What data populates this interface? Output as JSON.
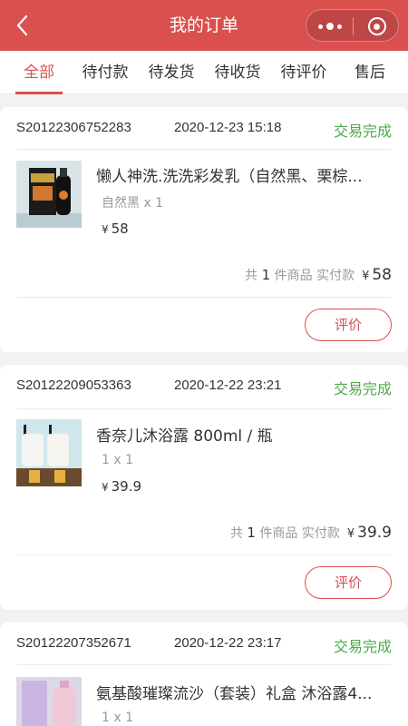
{
  "header": {
    "back_icon": "chevron-left-icon",
    "title": "我的订单",
    "more_icon": "more-dots-icon",
    "close_icon": "target-close-icon",
    "color": "#d9504f"
  },
  "tabs": [
    {
      "label": "全部",
      "active": true
    },
    {
      "label": "待付款"
    },
    {
      "label": "待发货"
    },
    {
      "label": "待收货"
    },
    {
      "label": "待评价"
    },
    {
      "label": "售后"
    }
  ],
  "summary_labels": {
    "prefix": "共",
    "unit": "件商品",
    "paid": "实付款",
    "currency": "¥"
  },
  "orders": [
    {
      "order_no": "S20122306752283",
      "time": "2020-12-23 15:18",
      "status": "交易完成",
      "product": {
        "name": "懒人神洗.洗洗彩发乳（自然黑、栗棕...",
        "spec": "自然黑 x 1",
        "price_symbol": "¥",
        "price": "58",
        "image": "hair-dye-bottle-image"
      },
      "count": "1",
      "total": "58",
      "action": "评价"
    },
    {
      "order_no": "S20122209053363",
      "time": "2020-12-22 23:21",
      "status": "交易完成",
      "product": {
        "name": "香奈儿沐浴露 800ml / 瓶",
        "spec": "1 x 1",
        "price_symbol": "¥",
        "price": "39.9",
        "image": "body-wash-bottles-image"
      },
      "count": "1",
      "total": "39.9",
      "action": "评价"
    },
    {
      "order_no": "S20122207352671",
      "time": "2020-12-22 23:17",
      "status": "交易完成",
      "product": {
        "name": "氨基酸璀璨流沙（套装）礼盒 沐浴露4...",
        "spec": "1 x 1",
        "image": "gift-box-set-image"
      }
    }
  ],
  "colors": {
    "accent": "#d9504f",
    "success": "#4fa84b",
    "background": "#f2f2f2"
  }
}
